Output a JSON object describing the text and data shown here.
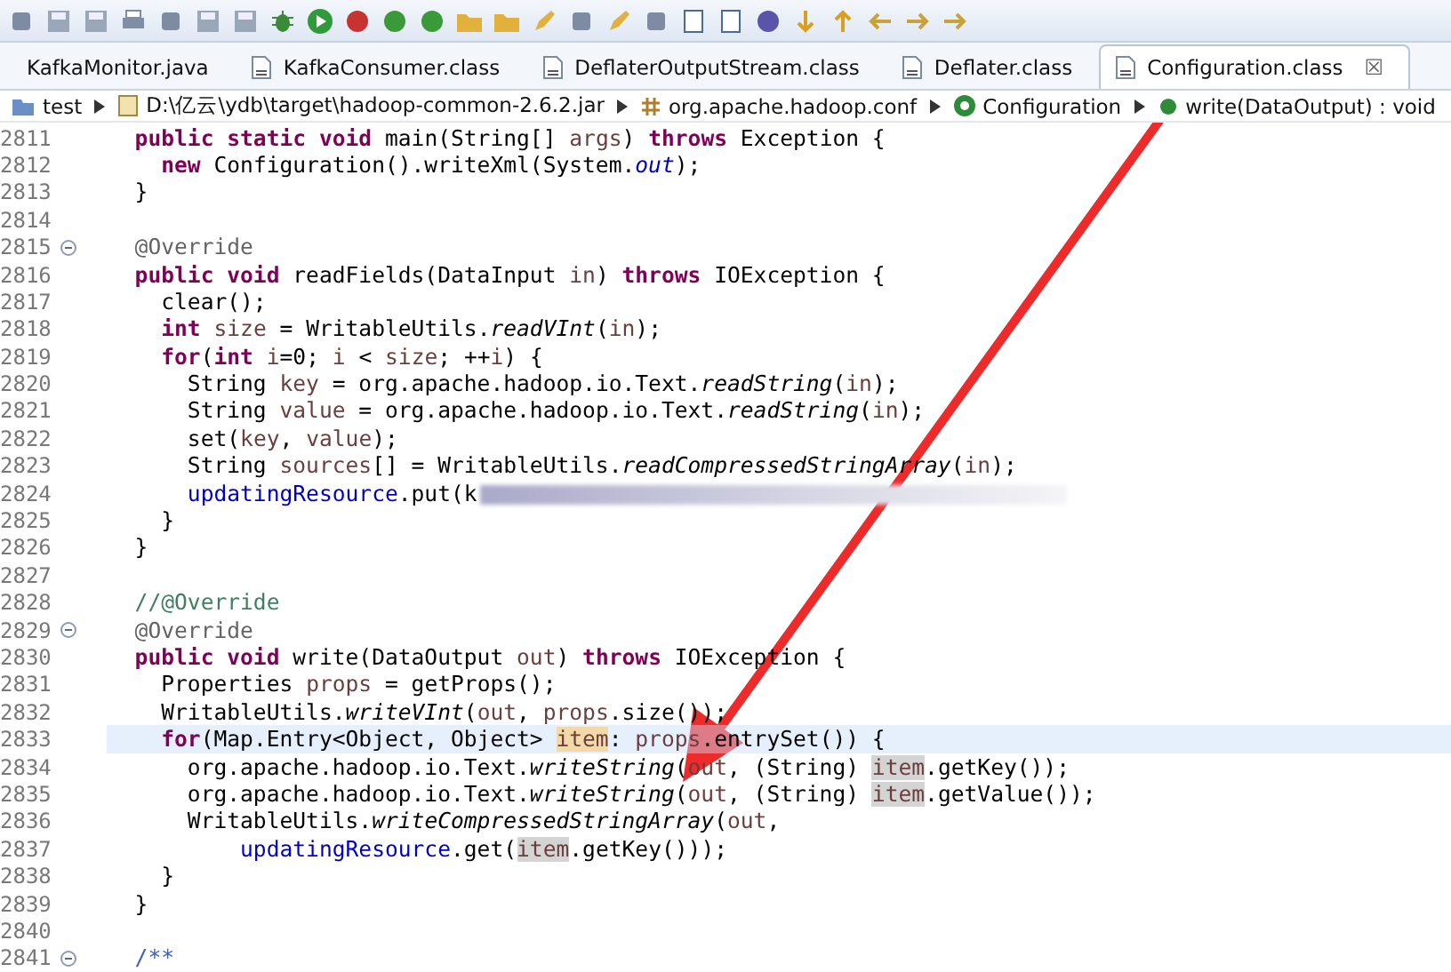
{
  "tabs": [
    {
      "label": "KafkaMonitor.java",
      "selected": false,
      "icon": false
    },
    {
      "label": "KafkaConsumer.class",
      "selected": false,
      "icon": true
    },
    {
      "label": "DeflaterOutputStream.class",
      "selected": false,
      "icon": true
    },
    {
      "label": "Deflater.class",
      "selected": false,
      "icon": true
    },
    {
      "label": "Configuration.class",
      "selected": true,
      "icon": true,
      "close": "☒"
    }
  ],
  "breadcrumbs": [
    {
      "kind": "project",
      "label": "test"
    },
    {
      "kind": "jar",
      "label": "D:\\亿云\\ydb\\target\\hadoop-common-2.6.2.jar"
    },
    {
      "kind": "package",
      "label": "org.apache.hadoop.conf"
    },
    {
      "kind": "class",
      "label": "Configuration"
    },
    {
      "kind": "method",
      "label": "write(DataOutput) : void"
    }
  ],
  "editor": {
    "lines": [
      {
        "number": "2811",
        "fold": false,
        "current": false,
        "tokens": [
          {
            "kind": "keyword",
            "text": "  public static void"
          },
          {
            "kind": "plain",
            "text": " main(String[] "
          },
          {
            "kind": "param",
            "text": "args"
          },
          {
            "kind": "plain",
            "text": ") "
          },
          {
            "kind": "keyword",
            "text": "throws"
          },
          {
            "kind": "plain",
            "text": " Exception {"
          }
        ]
      },
      {
        "number": "2812",
        "fold": false,
        "current": false,
        "tokens": [
          {
            "kind": "keyword",
            "text": "    new"
          },
          {
            "kind": "plain",
            "text": " Configuration().writeXml(System."
          },
          {
            "kind": "static-field",
            "text": "out"
          },
          {
            "kind": "plain",
            "text": ");"
          }
        ]
      },
      {
        "number": "2813",
        "fold": false,
        "current": false,
        "tokens": [
          {
            "kind": "plain",
            "text": "  }"
          }
        ]
      },
      {
        "number": "2814",
        "fold": false,
        "current": false
      },
      {
        "number": "2815",
        "fold": true,
        "current": false,
        "tokens": [
          {
            "kind": "annotation",
            "text": "  @Override"
          }
        ]
      },
      {
        "number": "2816",
        "fold": false,
        "current": false,
        "tokens": [
          {
            "kind": "keyword",
            "text": "  public void"
          },
          {
            "kind": "plain",
            "text": " readFields(DataInput "
          },
          {
            "kind": "param",
            "text": "in"
          },
          {
            "kind": "plain",
            "text": ") "
          },
          {
            "kind": "keyword",
            "text": "throws"
          },
          {
            "kind": "plain",
            "text": " IOException {"
          }
        ]
      },
      {
        "number": "2817",
        "fold": false,
        "current": false,
        "tokens": [
          {
            "kind": "plain",
            "text": "    clear();"
          }
        ]
      },
      {
        "number": "2818",
        "fold": false,
        "current": false,
        "tokens": [
          {
            "kind": "keyword",
            "text": "    int"
          },
          {
            "kind": "param",
            "text": " size"
          },
          {
            "kind": "plain",
            "text": " = WritableUtils."
          },
          {
            "kind": "static",
            "text": "readVInt"
          },
          {
            "kind": "plain",
            "text": "("
          },
          {
            "kind": "param",
            "text": "in"
          },
          {
            "kind": "plain",
            "text": ");"
          }
        ]
      },
      {
        "number": "2819",
        "fold": false,
        "current": false,
        "tokens": [
          {
            "kind": "keyword",
            "text": "    for"
          },
          {
            "kind": "plain",
            "text": "("
          },
          {
            "kind": "keyword",
            "text": "int"
          },
          {
            "kind": "param",
            "text": " i"
          },
          {
            "kind": "plain",
            "text": "=0; "
          },
          {
            "kind": "param",
            "text": "i"
          },
          {
            "kind": "plain",
            "text": " < "
          },
          {
            "kind": "param",
            "text": "size"
          },
          {
            "kind": "plain",
            "text": "; ++"
          },
          {
            "kind": "param",
            "text": "i"
          },
          {
            "kind": "plain",
            "text": ") {"
          }
        ]
      },
      {
        "number": "2820",
        "fold": false,
        "current": false,
        "tokens": [
          {
            "kind": "plain",
            "text": "      String "
          },
          {
            "kind": "param",
            "text": "key"
          },
          {
            "kind": "plain",
            "text": " = org.apache.hadoop.io.Text."
          },
          {
            "kind": "static",
            "text": "readString"
          },
          {
            "kind": "plain",
            "text": "("
          },
          {
            "kind": "param",
            "text": "in"
          },
          {
            "kind": "plain",
            "text": ");"
          }
        ]
      },
      {
        "number": "2821",
        "fold": false,
        "current": false,
        "tokens": [
          {
            "kind": "plain",
            "text": "      String "
          },
          {
            "kind": "param",
            "text": "value"
          },
          {
            "kind": "plain",
            "text": " = org.apache.hadoop.io.Text."
          },
          {
            "kind": "static",
            "text": "readString"
          },
          {
            "kind": "plain",
            "text": "("
          },
          {
            "kind": "param",
            "text": "in"
          },
          {
            "kind": "plain",
            "text": ");"
          }
        ]
      },
      {
        "number": "2822",
        "fold": false,
        "current": false,
        "tokens": [
          {
            "kind": "plain",
            "text": "      set("
          },
          {
            "kind": "param",
            "text": "key"
          },
          {
            "kind": "plain",
            "text": ", "
          },
          {
            "kind": "param",
            "text": "value"
          },
          {
            "kind": "plain",
            "text": ");"
          }
        ]
      },
      {
        "number": "2823",
        "fold": false,
        "current": false,
        "tokens": [
          {
            "kind": "plain",
            "text": "      String "
          },
          {
            "kind": "param",
            "text": "sources"
          },
          {
            "kind": "plain",
            "text": "[] = WritableUtils."
          },
          {
            "kind": "static",
            "text": "readCompressedStringArray"
          },
          {
            "kind": "plain",
            "text": "("
          },
          {
            "kind": "param",
            "text": "in"
          },
          {
            "kind": "plain",
            "text": ");"
          }
        ]
      },
      {
        "number": "2824",
        "fold": false,
        "current": false,
        "blurred": true,
        "tokens": [
          {
            "kind": "field",
            "text": "      updatingResource"
          },
          {
            "kind": "plain",
            "text": ".put(k"
          }
        ]
      },
      {
        "number": "2825",
        "fold": false,
        "current": false,
        "tokens": [
          {
            "kind": "plain",
            "text": "    }"
          }
        ]
      },
      {
        "number": "2826",
        "fold": false,
        "current": false,
        "tokens": [
          {
            "kind": "plain",
            "text": "  }"
          }
        ]
      },
      {
        "number": "2827",
        "fold": false,
        "current": false
      },
      {
        "number": "2828",
        "fold": false,
        "current": false,
        "tokens": [
          {
            "kind": "comment",
            "text": "  //@Override"
          }
        ]
      },
      {
        "number": "2829",
        "fold": true,
        "current": false,
        "tokens": [
          {
            "kind": "annotation",
            "text": "  @Override"
          }
        ]
      },
      {
        "number": "2830",
        "fold": false,
        "current": false,
        "tokens": [
          {
            "kind": "keyword",
            "text": "  public void"
          },
          {
            "kind": "plain",
            "text": " write(DataOutput "
          },
          {
            "kind": "param",
            "text": "out"
          },
          {
            "kind": "plain",
            "text": ") "
          },
          {
            "kind": "keyword",
            "text": "throws"
          },
          {
            "kind": "plain",
            "text": " IOException {"
          }
        ]
      },
      {
        "number": "2831",
        "fold": false,
        "current": false,
        "tokens": [
          {
            "kind": "plain",
            "text": "    Properties "
          },
          {
            "kind": "param",
            "text": "props"
          },
          {
            "kind": "plain",
            "text": " = getProps();"
          }
        ]
      },
      {
        "number": "2832",
        "fold": false,
        "current": false,
        "tokens": [
          {
            "kind": "plain",
            "text": "    WritableUtils."
          },
          {
            "kind": "static",
            "text": "writeVInt"
          },
          {
            "kind": "plain",
            "text": "("
          },
          {
            "kind": "param",
            "text": "out"
          },
          {
            "kind": "plain",
            "text": ", "
          },
          {
            "kind": "param",
            "text": "props"
          },
          {
            "kind": "plain",
            "text": ".size());"
          }
        ]
      },
      {
        "number": "2833",
        "fold": false,
        "current": true,
        "tokens": [
          {
            "kind": "keyword",
            "text": "    for"
          },
          {
            "kind": "plain",
            "text": "(Map.Entry<Object, Object> "
          },
          {
            "kind": "write-occurrence",
            "text": "item"
          },
          {
            "kind": "plain",
            "text": ": "
          },
          {
            "kind": "param",
            "text": "props"
          },
          {
            "kind": "plain",
            "text": ".entrySet()) {"
          }
        ]
      },
      {
        "number": "2834",
        "fold": false,
        "current": false,
        "tokens": [
          {
            "kind": "plain",
            "text": "      org.apache.hadoop.io.Text."
          },
          {
            "kind": "static",
            "text": "writeString"
          },
          {
            "kind": "plain",
            "text": "("
          },
          {
            "kind": "param",
            "text": "out"
          },
          {
            "kind": "plain",
            "text": ", (String) "
          },
          {
            "kind": "occurrence",
            "text": "item"
          },
          {
            "kind": "plain",
            "text": ".getKey());"
          }
        ]
      },
      {
        "number": "2835",
        "fold": false,
        "current": false,
        "tokens": [
          {
            "kind": "plain",
            "text": "      org.apache.hadoop.io.Text."
          },
          {
            "kind": "static",
            "text": "writeString"
          },
          {
            "kind": "plain",
            "text": "("
          },
          {
            "kind": "param",
            "text": "out"
          },
          {
            "kind": "plain",
            "text": ", (String) "
          },
          {
            "kind": "occurrence",
            "text": "item"
          },
          {
            "kind": "plain",
            "text": ".getValue());"
          }
        ]
      },
      {
        "number": "2836",
        "fold": false,
        "current": false,
        "tokens": [
          {
            "kind": "plain",
            "text": "      WritableUtils."
          },
          {
            "kind": "static",
            "text": "writeCompressedStringArray"
          },
          {
            "kind": "plain",
            "text": "("
          },
          {
            "kind": "param",
            "text": "out"
          },
          {
            "kind": "plain",
            "text": ","
          }
        ]
      },
      {
        "number": "2837",
        "fold": false,
        "current": false,
        "tokens": [
          {
            "kind": "field",
            "text": "          updatingResource"
          },
          {
            "kind": "plain",
            "text": ".get("
          },
          {
            "kind": "occurrence",
            "text": "item"
          },
          {
            "kind": "plain",
            "text": ".getKey()));"
          }
        ]
      },
      {
        "number": "2838",
        "fold": false,
        "current": false,
        "tokens": [
          {
            "kind": "plain",
            "text": "    }"
          }
        ]
      },
      {
        "number": "2839",
        "fold": false,
        "current": false,
        "tokens": [
          {
            "kind": "plain",
            "text": "  }"
          }
        ]
      },
      {
        "number": "2840",
        "fold": false,
        "current": false
      },
      {
        "number": "2841",
        "fold": true,
        "current": false,
        "tokens": [
          {
            "kind": "javadoc",
            "text": "  /**"
          }
        ]
      }
    ]
  },
  "annotation_arrow": {
    "shown": true
  }
}
